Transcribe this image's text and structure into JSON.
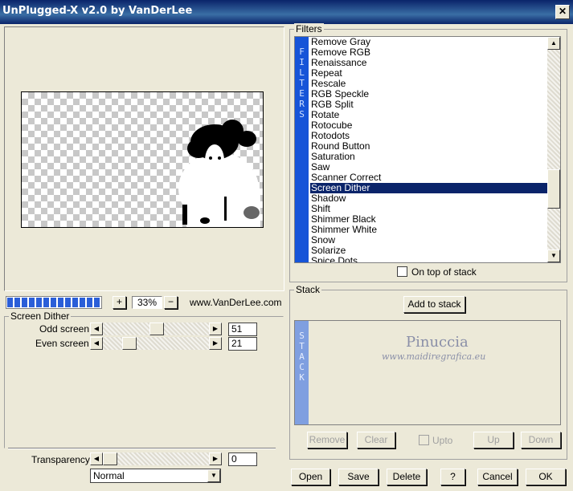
{
  "window": {
    "title": "UnPlugged-X v2.0 by VanDerLee",
    "close_glyph": "✕"
  },
  "preview": {
    "zoom": "33%",
    "zoom_in": "+",
    "zoom_out": "−",
    "website": "www.VanDerLee.com",
    "progress_segments": 13
  },
  "filters": {
    "group_label": "Filters",
    "vertical_label": "FILTERS",
    "items": [
      "Remove Gray",
      "Remove RGB",
      "Renaissance",
      "Repeat",
      "Rescale",
      "RGB Speckle",
      "RGB Split",
      "Rotate",
      "Rotocube",
      "Rotodots",
      "Round Button",
      "Saturation",
      "Saw",
      "Scanner Correct",
      "Screen Dither",
      "Shadow",
      "Shift",
      "Shimmer Black",
      "Shimmer White",
      "Snow",
      "Solarize",
      "Spice Dots"
    ],
    "selected": "Screen Dither",
    "on_top_label": "On top of stack"
  },
  "params": {
    "group_label": "Screen Dither",
    "odd_label": "Odd screen",
    "odd_value": "51",
    "odd_level": 51,
    "even_label": "Even screen",
    "even_value": "21",
    "even_level": 21
  },
  "transparency": {
    "label": "Transparency",
    "value": "0",
    "level": 0,
    "blend_mode": "Normal"
  },
  "stack": {
    "group_label": "Stack",
    "add_button": "Add to stack",
    "vertical_label": "STACK",
    "watermark_name": "Pinuccia",
    "watermark_url": "www.maidiregrafica.eu",
    "remove": "Remove",
    "clear": "Clear",
    "upto": "Upto",
    "up": "Up",
    "down": "Down"
  },
  "bottom": {
    "open": "Open",
    "save": "Save",
    "delete": "Delete",
    "help": "?",
    "cancel": "Cancel",
    "ok": "OK"
  }
}
